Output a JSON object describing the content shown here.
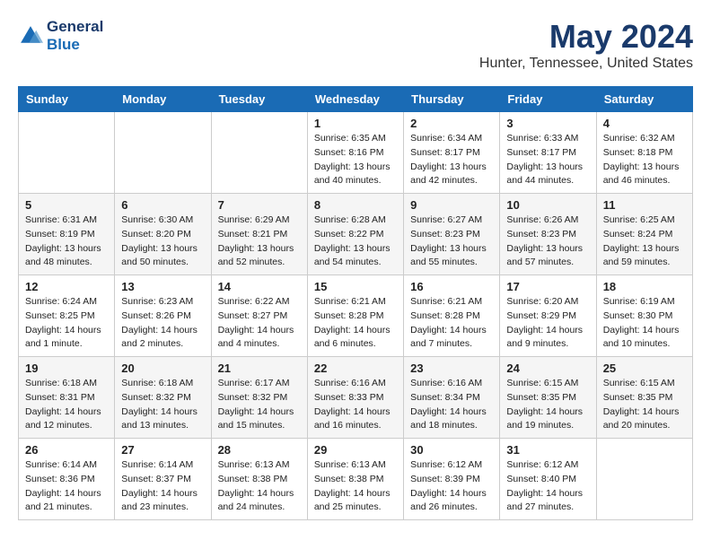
{
  "header": {
    "logo_line1": "General",
    "logo_line2": "Blue",
    "title": "May 2024",
    "location": "Hunter, Tennessee, United States"
  },
  "weekdays": [
    "Sunday",
    "Monday",
    "Tuesday",
    "Wednesday",
    "Thursday",
    "Friday",
    "Saturday"
  ],
  "weeks": [
    [
      {
        "day": "",
        "info": ""
      },
      {
        "day": "",
        "info": ""
      },
      {
        "day": "",
        "info": ""
      },
      {
        "day": "1",
        "info": "Sunrise: 6:35 AM\nSunset: 8:16 PM\nDaylight: 13 hours\nand 40 minutes."
      },
      {
        "day": "2",
        "info": "Sunrise: 6:34 AM\nSunset: 8:17 PM\nDaylight: 13 hours\nand 42 minutes."
      },
      {
        "day": "3",
        "info": "Sunrise: 6:33 AM\nSunset: 8:17 PM\nDaylight: 13 hours\nand 44 minutes."
      },
      {
        "day": "4",
        "info": "Sunrise: 6:32 AM\nSunset: 8:18 PM\nDaylight: 13 hours\nand 46 minutes."
      }
    ],
    [
      {
        "day": "5",
        "info": "Sunrise: 6:31 AM\nSunset: 8:19 PM\nDaylight: 13 hours\nand 48 minutes."
      },
      {
        "day": "6",
        "info": "Sunrise: 6:30 AM\nSunset: 8:20 PM\nDaylight: 13 hours\nand 50 minutes."
      },
      {
        "day": "7",
        "info": "Sunrise: 6:29 AM\nSunset: 8:21 PM\nDaylight: 13 hours\nand 52 minutes."
      },
      {
        "day": "8",
        "info": "Sunrise: 6:28 AM\nSunset: 8:22 PM\nDaylight: 13 hours\nand 54 minutes."
      },
      {
        "day": "9",
        "info": "Sunrise: 6:27 AM\nSunset: 8:23 PM\nDaylight: 13 hours\nand 55 minutes."
      },
      {
        "day": "10",
        "info": "Sunrise: 6:26 AM\nSunset: 8:23 PM\nDaylight: 13 hours\nand 57 minutes."
      },
      {
        "day": "11",
        "info": "Sunrise: 6:25 AM\nSunset: 8:24 PM\nDaylight: 13 hours\nand 59 minutes."
      }
    ],
    [
      {
        "day": "12",
        "info": "Sunrise: 6:24 AM\nSunset: 8:25 PM\nDaylight: 14 hours\nand 1 minute."
      },
      {
        "day": "13",
        "info": "Sunrise: 6:23 AM\nSunset: 8:26 PM\nDaylight: 14 hours\nand 2 minutes."
      },
      {
        "day": "14",
        "info": "Sunrise: 6:22 AM\nSunset: 8:27 PM\nDaylight: 14 hours\nand 4 minutes."
      },
      {
        "day": "15",
        "info": "Sunrise: 6:21 AM\nSunset: 8:28 PM\nDaylight: 14 hours\nand 6 minutes."
      },
      {
        "day": "16",
        "info": "Sunrise: 6:21 AM\nSunset: 8:28 PM\nDaylight: 14 hours\nand 7 minutes."
      },
      {
        "day": "17",
        "info": "Sunrise: 6:20 AM\nSunset: 8:29 PM\nDaylight: 14 hours\nand 9 minutes."
      },
      {
        "day": "18",
        "info": "Sunrise: 6:19 AM\nSunset: 8:30 PM\nDaylight: 14 hours\nand 10 minutes."
      }
    ],
    [
      {
        "day": "19",
        "info": "Sunrise: 6:18 AM\nSunset: 8:31 PM\nDaylight: 14 hours\nand 12 minutes."
      },
      {
        "day": "20",
        "info": "Sunrise: 6:18 AM\nSunset: 8:32 PM\nDaylight: 14 hours\nand 13 minutes."
      },
      {
        "day": "21",
        "info": "Sunrise: 6:17 AM\nSunset: 8:32 PM\nDaylight: 14 hours\nand 15 minutes."
      },
      {
        "day": "22",
        "info": "Sunrise: 6:16 AM\nSunset: 8:33 PM\nDaylight: 14 hours\nand 16 minutes."
      },
      {
        "day": "23",
        "info": "Sunrise: 6:16 AM\nSunset: 8:34 PM\nDaylight: 14 hours\nand 18 minutes."
      },
      {
        "day": "24",
        "info": "Sunrise: 6:15 AM\nSunset: 8:35 PM\nDaylight: 14 hours\nand 19 minutes."
      },
      {
        "day": "25",
        "info": "Sunrise: 6:15 AM\nSunset: 8:35 PM\nDaylight: 14 hours\nand 20 minutes."
      }
    ],
    [
      {
        "day": "26",
        "info": "Sunrise: 6:14 AM\nSunset: 8:36 PM\nDaylight: 14 hours\nand 21 minutes."
      },
      {
        "day": "27",
        "info": "Sunrise: 6:14 AM\nSunset: 8:37 PM\nDaylight: 14 hours\nand 23 minutes."
      },
      {
        "day": "28",
        "info": "Sunrise: 6:13 AM\nSunset: 8:38 PM\nDaylight: 14 hours\nand 24 minutes."
      },
      {
        "day": "29",
        "info": "Sunrise: 6:13 AM\nSunset: 8:38 PM\nDaylight: 14 hours\nand 25 minutes."
      },
      {
        "day": "30",
        "info": "Sunrise: 6:12 AM\nSunset: 8:39 PM\nDaylight: 14 hours\nand 26 minutes."
      },
      {
        "day": "31",
        "info": "Sunrise: 6:12 AM\nSunset: 8:40 PM\nDaylight: 14 hours\nand 27 minutes."
      },
      {
        "day": "",
        "info": ""
      }
    ]
  ]
}
